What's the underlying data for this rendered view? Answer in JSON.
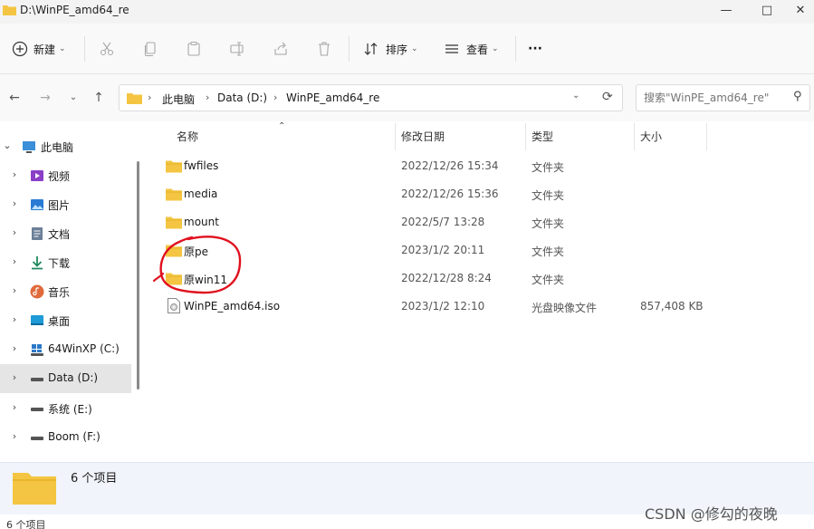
{
  "window": {
    "title": "D:\\WinPE_amd64_re",
    "minimize_icon": "minimize-icon",
    "maximize_icon": "maximize-icon",
    "close_icon": "close-icon"
  },
  "toolbar": {
    "new_label": "新建",
    "sort_label": "排序",
    "view_label": "查看",
    "more_label": "···"
  },
  "address": {
    "crumbs": [
      "此电脑",
      "Data (D:)",
      "WinPE_amd64_re"
    ]
  },
  "search": {
    "placeholder": "搜索\"WinPE_amd64_re\""
  },
  "sidebar": {
    "items": [
      {
        "label": "此电脑",
        "icon": "this-pc-icon",
        "expanded": true
      },
      {
        "label": "视频",
        "icon": "videos-icon"
      },
      {
        "label": "图片",
        "icon": "pictures-icon"
      },
      {
        "label": "文档",
        "icon": "documents-icon"
      },
      {
        "label": "下载",
        "icon": "downloads-icon"
      },
      {
        "label": "音乐",
        "icon": "music-icon"
      },
      {
        "label": "桌面",
        "icon": "desktop-icon"
      },
      {
        "label": "64WinXP  (C:)",
        "icon": "drive-icon"
      },
      {
        "label": "Data (D:)",
        "icon": "drive-icon",
        "selected": true
      },
      {
        "label": "系统 (E:)",
        "icon": "drive-icon"
      },
      {
        "label": "Boom (F:)",
        "icon": "drive-icon"
      }
    ]
  },
  "columns": {
    "name": "名称",
    "date": "修改日期",
    "type": "类型",
    "size": "大小"
  },
  "files": [
    {
      "name": "fwfiles",
      "date": "2022/12/26 15:34",
      "type": "文件夹",
      "size": "",
      "icon": "folder-icon"
    },
    {
      "name": "media",
      "date": "2022/12/26 15:36",
      "type": "文件夹",
      "size": "",
      "icon": "folder-icon"
    },
    {
      "name": "mount",
      "date": "2022/5/7 13:28",
      "type": "文件夹",
      "size": "",
      "icon": "folder-icon"
    },
    {
      "name": "原pe",
      "date": "2023/1/2 20:11",
      "type": "文件夹",
      "size": "",
      "icon": "folder-icon"
    },
    {
      "name": "原win11",
      "date": "2022/12/28 8:24",
      "type": "文件夹",
      "size": "",
      "icon": "folder-icon"
    },
    {
      "name": "WinPE_amd64.iso",
      "date": "2023/1/2 12:10",
      "type": "光盘映像文件",
      "size": "857,408 KB",
      "icon": "iso-file-icon"
    }
  ],
  "details": {
    "count": "6 个项目"
  },
  "status": {
    "count": "6 个项目"
  },
  "watermark": "CSDN @修勾的夜晚",
  "colors": {
    "folder": "#f4c542",
    "annotation": "#e0101e",
    "selection": "#e5e5e5"
  }
}
